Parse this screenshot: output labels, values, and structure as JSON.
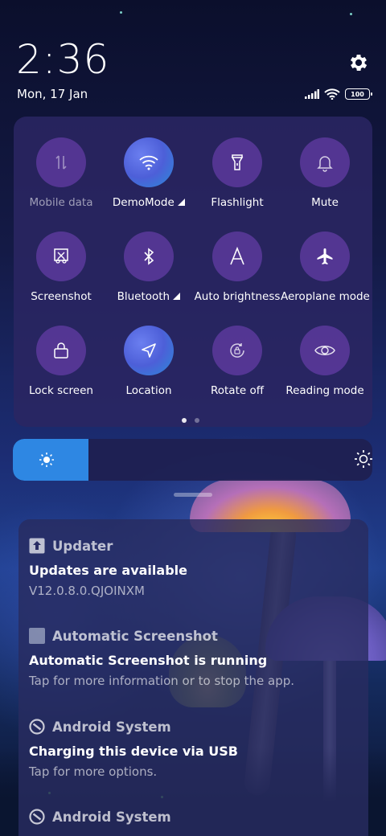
{
  "status_bar": {
    "time": "2:36",
    "date": "Mon, 17 Jan",
    "battery": "100",
    "icons": [
      "signal-icon",
      "wifi-icon",
      "battery-icon"
    ]
  },
  "quick_settings": {
    "tiles": [
      {
        "label": "Mobile data",
        "icon": "mobile-data-icon",
        "active": false,
        "disabled": true
      },
      {
        "label": "DemoMode",
        "icon": "wifi-icon",
        "active": true,
        "has_arrow": true
      },
      {
        "label": "Flashlight",
        "icon": "flashlight-icon",
        "active": false
      },
      {
        "label": "Mute",
        "icon": "bell-icon",
        "active": false
      },
      {
        "label": "Screenshot",
        "icon": "screenshot-icon",
        "active": false
      },
      {
        "label": "Bluetooth",
        "icon": "bluetooth-icon",
        "active": false,
        "has_arrow": true
      },
      {
        "label": "Auto brightness",
        "icon": "auto-brightness-icon",
        "active": false
      },
      {
        "label": "Aeroplane mode",
        "icon": "airplane-icon",
        "active": false
      },
      {
        "label": "Lock screen",
        "icon": "lock-icon",
        "active": false
      },
      {
        "label": "Location",
        "icon": "location-icon",
        "active": true
      },
      {
        "label": "Rotate off",
        "icon": "rotate-lock-icon",
        "active": false
      },
      {
        "label": "Reading mode",
        "icon": "eye-icon",
        "active": false
      }
    ],
    "page_count": 2,
    "current_page": 1
  },
  "brightness": {
    "level": 0.21,
    "accent_color": "#2e87e3"
  },
  "notifications": [
    {
      "app": "Updater",
      "app_icon": "upload-icon",
      "title": "Updates are available",
      "text": "V12.0.8.0.QJOINXM"
    },
    {
      "app": "Automatic Screenshot",
      "app_icon": "app-square-icon",
      "title": "Automatic Screenshot is running",
      "text": "Tap for more information or to stop the app."
    },
    {
      "app": "Android System",
      "app_icon": "android-system-icon",
      "title": "Charging this device via USB",
      "text": "Tap for more options."
    },
    {
      "app": "Android System",
      "app_icon": "android-system-icon",
      "title": "",
      "text": ""
    }
  ]
}
